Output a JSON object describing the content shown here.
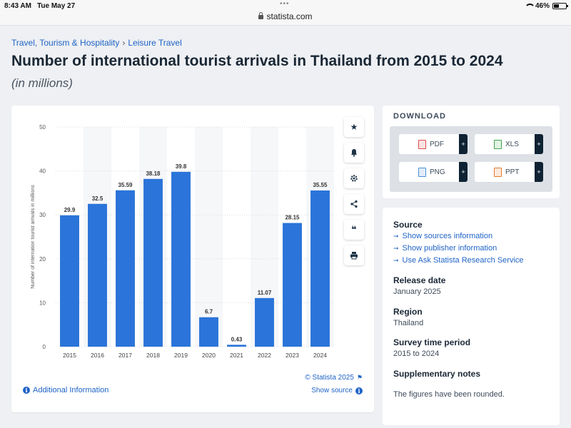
{
  "status_bar": {
    "time": "8:43 AM",
    "date": "Tue May 27",
    "url": "statista.com",
    "battery": "46%",
    "battery_level": 0.46
  },
  "breadcrumb": {
    "items": [
      "Travel, Tourism & Hospitality",
      "Leisure Travel"
    ],
    "separator": "›"
  },
  "page": {
    "title": "Number of international tourist arrivals in Thailand from 2015 to 2024",
    "subtitle": "(in millions)"
  },
  "chart_data": {
    "type": "bar",
    "categories": [
      "2015",
      "2016",
      "2017",
      "2018",
      "2019",
      "2020",
      "2021",
      "2022",
      "2023",
      "2024"
    ],
    "values": [
      29.9,
      32.5,
      35.59,
      38.18,
      39.8,
      6.7,
      0.43,
      11.07,
      28.15,
      35.55
    ],
    "data_labels": [
      "29.9",
      "32.5",
      "35.59",
      "38.18",
      "39.8",
      "6.7",
      "0.43",
      "11.07",
      "28.15",
      "35.55"
    ],
    "ylabel": "Number of internation tourist arrivals in millions",
    "xlabel": "",
    "ylim": [
      0,
      50
    ],
    "yticks": [
      0,
      10,
      20,
      30,
      40,
      50
    ],
    "grid": true,
    "bar_color": "#2b74d9"
  },
  "chart_card": {
    "copyright": "© Statista 2025",
    "additional_info": "Additional Information",
    "show_source": "Show source",
    "tools": [
      "star-icon",
      "bell-icon",
      "gear-icon",
      "share-icon",
      "quote-icon",
      "print-icon"
    ]
  },
  "download": {
    "title": "DOWNLOAD",
    "buttons": [
      {
        "label": "PDF",
        "icon": "pdf-icon",
        "color": "#e04b4b"
      },
      {
        "label": "XLS",
        "icon": "xls-icon",
        "color": "#3fa34d"
      },
      {
        "label": "PNG",
        "icon": "png-icon",
        "color": "#4a90d9"
      },
      {
        "label": "PPT",
        "icon": "ppt-icon",
        "color": "#e6782b"
      }
    ],
    "plus": "+"
  },
  "source": {
    "heading": "Source",
    "links": [
      "Show sources information",
      "Show publisher information",
      "Use Ask Statista Research Service"
    ],
    "release_date_label": "Release date",
    "release_date": "January 2025",
    "region_label": "Region",
    "region": "Thailand",
    "survey_label": "Survey time period",
    "survey": "2015 to 2024",
    "notes_label": "Supplementary notes",
    "notes": "The figures have been rounded."
  },
  "colors": {
    "accent": "#1f63c6",
    "bar": "#2b74d9",
    "dark": "#0e2233"
  }
}
